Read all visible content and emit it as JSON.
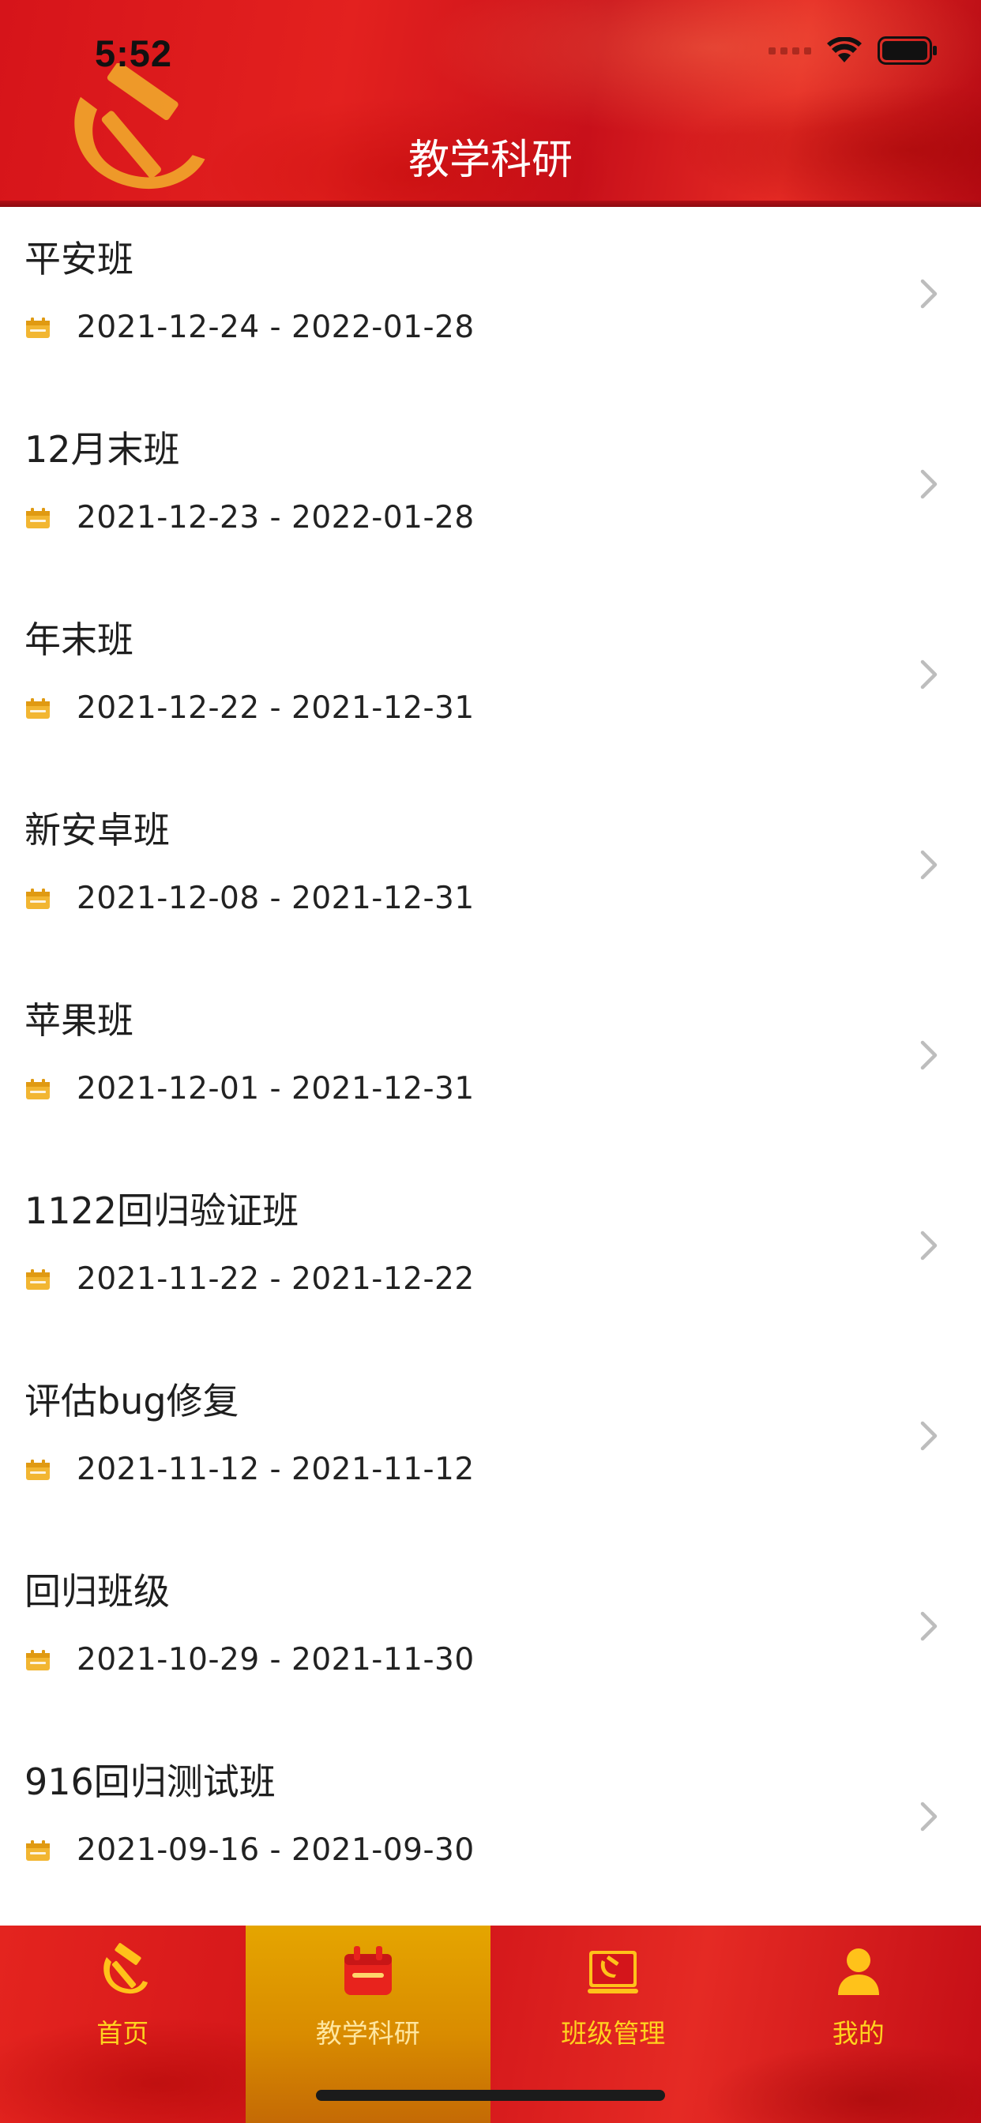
{
  "status_bar": {
    "time": "5:52"
  },
  "header": {
    "title": "教学科研"
  },
  "classes": [
    {
      "name": "平安班",
      "date_range": "2021-12-24 - 2022-01-28"
    },
    {
      "name": "12月末班",
      "date_range": "2021-12-23 - 2022-01-28"
    },
    {
      "name": "年末班",
      "date_range": "2021-12-22 - 2021-12-31"
    },
    {
      "name": "新安卓班",
      "date_range": "2021-12-08 - 2021-12-31"
    },
    {
      "name": "苹果班",
      "date_range": "2021-12-01 - 2021-12-31"
    },
    {
      "name": "1122回归验证班",
      "date_range": "2021-11-22 - 2021-12-22"
    },
    {
      "name": "评估bug修复",
      "date_range": "2021-11-12 - 2021-11-12"
    },
    {
      "name": "回归班级",
      "date_range": "2021-10-29 - 2021-11-30"
    },
    {
      "name": "916回归测试班",
      "date_range": "2021-09-16 - 2021-09-30"
    }
  ],
  "tabbar": {
    "tabs": [
      {
        "label": "首页",
        "icon": "hammer-sickle-icon",
        "active": false
      },
      {
        "label": "教学科研",
        "icon": "calendar-icon",
        "active": true
      },
      {
        "label": "班级管理",
        "icon": "party-book-icon",
        "active": false
      },
      {
        "label": "我的",
        "icon": "person-icon",
        "active": false
      }
    ]
  },
  "colors": {
    "header_red": "#d6141a",
    "accent_yellow": "#f2b632",
    "tab_active": "#e5a500",
    "tab_label": "#ffd21f"
  }
}
